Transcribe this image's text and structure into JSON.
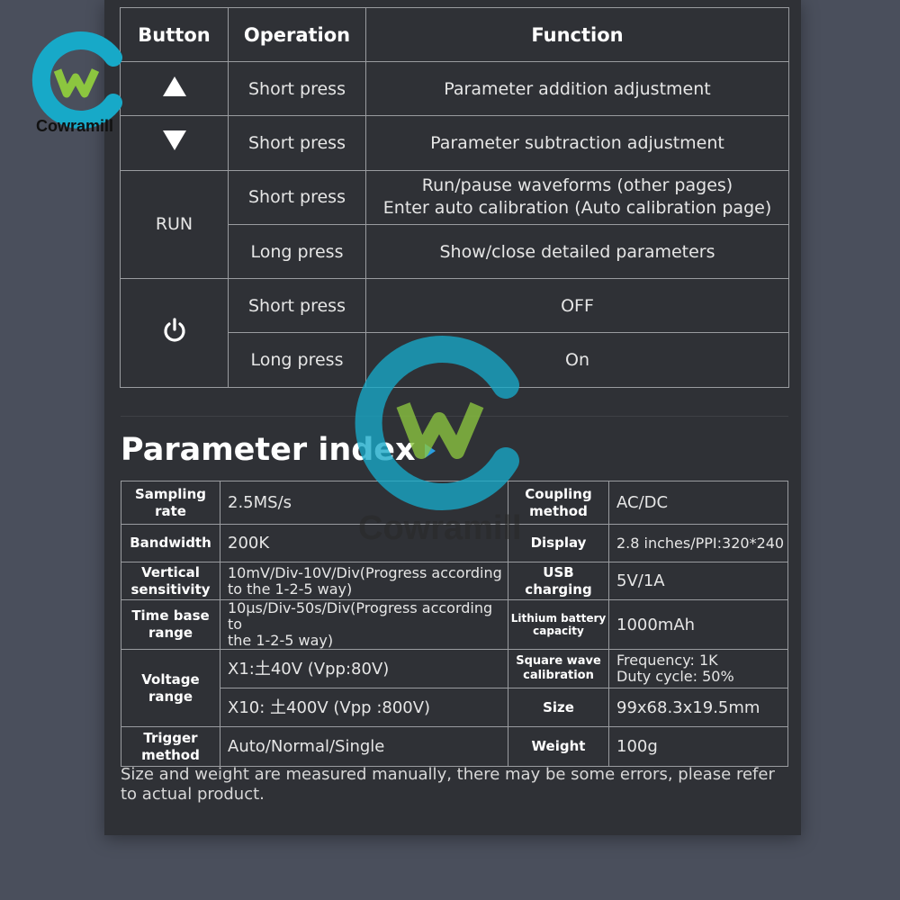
{
  "operations": {
    "headers": [
      "Button",
      "Operation",
      "Function"
    ],
    "rows": [
      {
        "button_icon": "up-triangle-icon",
        "operation": "Short press",
        "function": "Parameter addition adjustment"
      },
      {
        "button_icon": "down-triangle-icon",
        "operation": "Short press",
        "function": "Parameter subtraction adjustment"
      },
      {
        "button_label": "RUN",
        "operation": "Short press",
        "function_lines": [
          "Run/pause waveforms (other pages)",
          "Enter auto calibration (Auto calibration page)"
        ]
      },
      {
        "operation": "Long press",
        "function": "Show/close detailed parameters"
      },
      {
        "button_icon": "power-icon",
        "operation": "Short press",
        "function": "OFF"
      },
      {
        "operation": "Long press",
        "function": "On"
      }
    ]
  },
  "heading": "Parameter index",
  "params": {
    "sampling_rate": {
      "label_lines": [
        "Sampling",
        "rate"
      ],
      "value": "2.5MS/s"
    },
    "coupling_method": {
      "label_lines": [
        "Coupling",
        "method"
      ],
      "value": "AC/DC"
    },
    "bandwidth": {
      "label": "Bandwidth",
      "value": "200K"
    },
    "display": {
      "label": "Display",
      "value": "2.8 inches/PPI:320*240"
    },
    "vertical_sensitivity": {
      "label_lines": [
        "Vertical",
        "sensitivity"
      ],
      "value_lines": [
        "10mV/Div-10V/Div(Progress according",
        "to the 1-2-5 way)"
      ]
    },
    "usb_charging": {
      "label_lines": [
        "USB",
        "charging"
      ],
      "value": "5V/1A"
    },
    "time_base_range": {
      "label_lines": [
        "Time base",
        "range"
      ],
      "value_lines": [
        "10μs/Div-50s/Div(Progress according to",
        "the 1-2-5 way)"
      ]
    },
    "lithium_battery": {
      "label_lines": [
        "Lithium battery",
        "capacity"
      ],
      "value": "1000mAh"
    },
    "voltage_range": {
      "label_lines": [
        "Voltage",
        "range"
      ],
      "value_x1": "X1:土40V (Vpp:80V)",
      "value_x10": "X10: 土400V (Vpp :800V)"
    },
    "square_wave": {
      "label_lines": [
        "Square wave",
        "calibration"
      ],
      "value_lines": [
        "Frequency: 1K",
        "Duty cycle: 50%"
      ]
    },
    "size": {
      "label": "Size",
      "value": "99x68.3x19.5mm"
    },
    "trigger_method": {
      "label_lines": [
        "Trigger",
        "method"
      ],
      "value": "Auto/Normal/Single"
    },
    "weight": {
      "label": "Weight",
      "value": "100g"
    }
  },
  "note": "Size and weight are measured manually, there may be some errors, please refer to actual product.",
  "brand": {
    "name": "Cowramill",
    "ring_color": "#17a9c8",
    "w_color": "#8cc63f"
  }
}
